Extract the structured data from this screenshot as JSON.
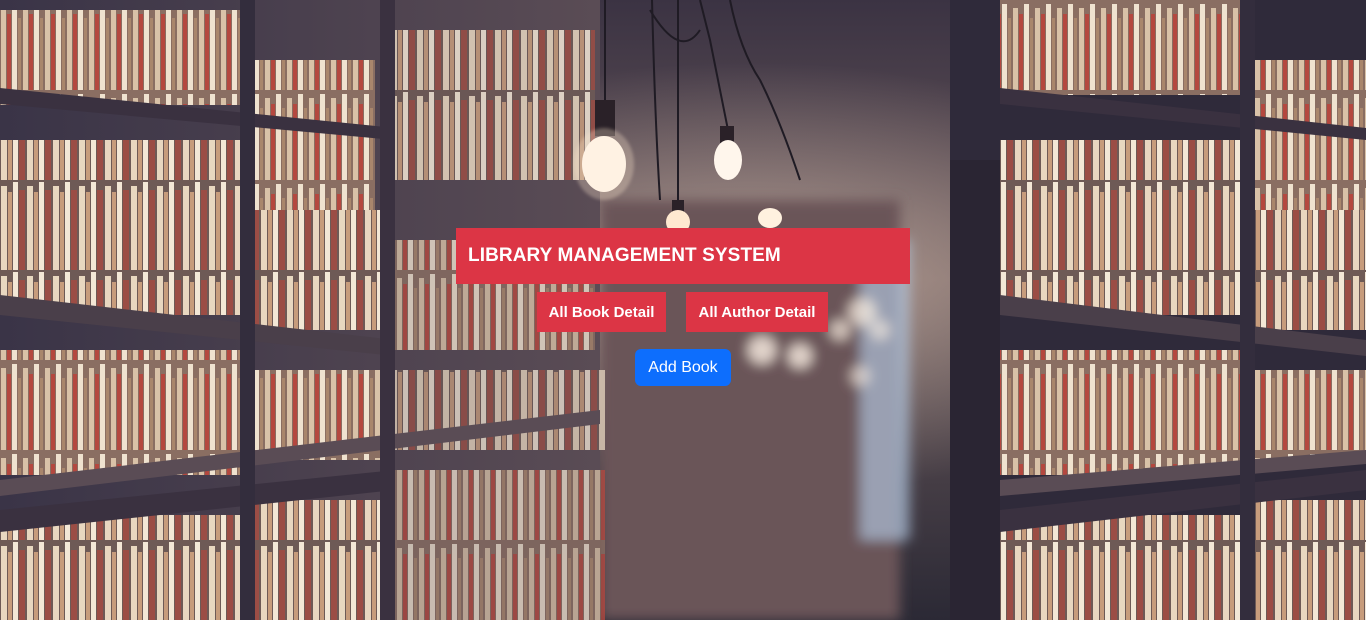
{
  "header": {
    "title": "LIBRARY MANAGEMENT SYSTEM"
  },
  "nav": {
    "all_books_label": "All Book Detail",
    "all_authors_label": "All Author Detail"
  },
  "actions": {
    "add_book_label": "Add Book"
  },
  "theme": {
    "title_bg": "#dc3545",
    "nav_bg": "#dc3545",
    "add_button_bg": "#0d6efd",
    "text_color": "#ffffff"
  }
}
